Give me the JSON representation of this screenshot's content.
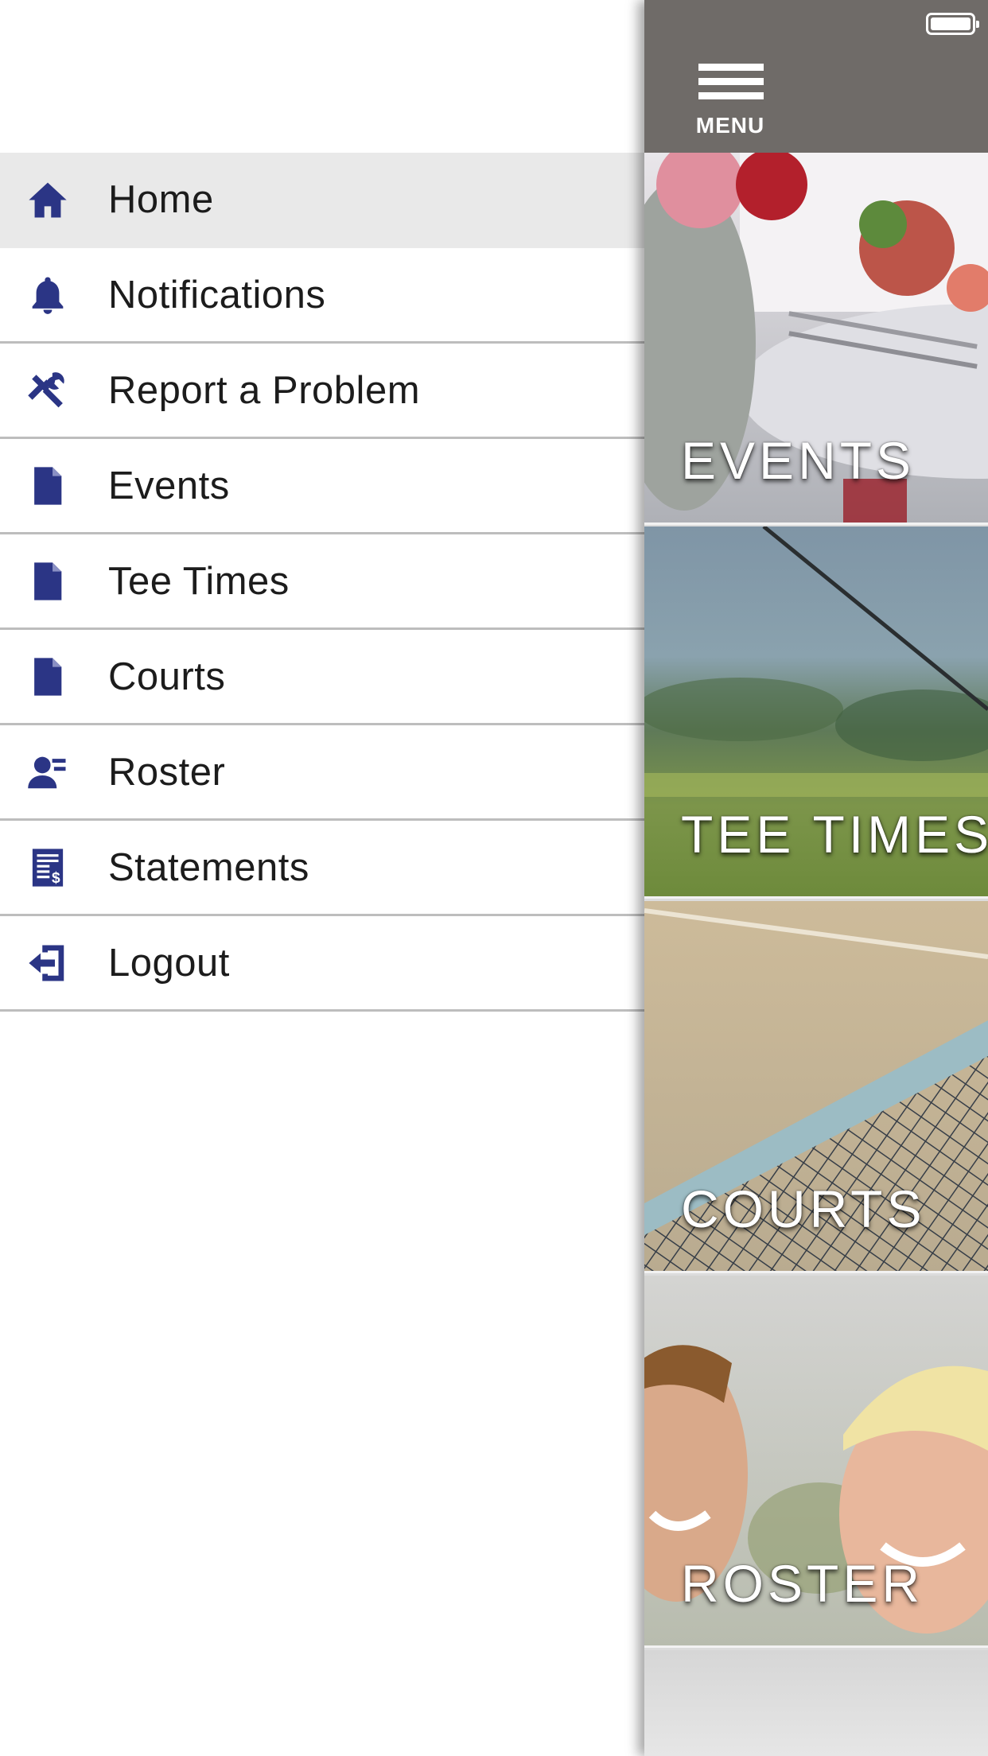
{
  "colors": {
    "icon": "#2b3585",
    "topbar": "#6f6b68",
    "active_row": "#e9e9e9",
    "divider": "#bdbdbd"
  },
  "status_bar": {
    "battery_icon": "battery-icon"
  },
  "header": {
    "menu_label": "MENU",
    "menu_icon": "hamburger-icon"
  },
  "drawer": {
    "items": [
      {
        "label": "Home",
        "icon": "home-icon",
        "active": true
      },
      {
        "label": "Notifications",
        "icon": "bell-icon",
        "active": false
      },
      {
        "label": "Report a Problem",
        "icon": "tools-icon",
        "active": false
      },
      {
        "label": "Events",
        "icon": "document-icon",
        "active": false
      },
      {
        "label": "Tee Times",
        "icon": "document-icon",
        "active": false
      },
      {
        "label": "Courts",
        "icon": "document-icon",
        "active": false
      },
      {
        "label": "Roster",
        "icon": "roster-icon",
        "active": false
      },
      {
        "label": "Statements",
        "icon": "statements-icon",
        "active": false
      },
      {
        "label": "Logout",
        "icon": "logout-icon",
        "active": false
      }
    ]
  },
  "tiles": [
    {
      "label": "EVENTS"
    },
    {
      "label": "TEE TIMES"
    },
    {
      "label": "COURTS"
    },
    {
      "label": "ROSTER"
    }
  ]
}
